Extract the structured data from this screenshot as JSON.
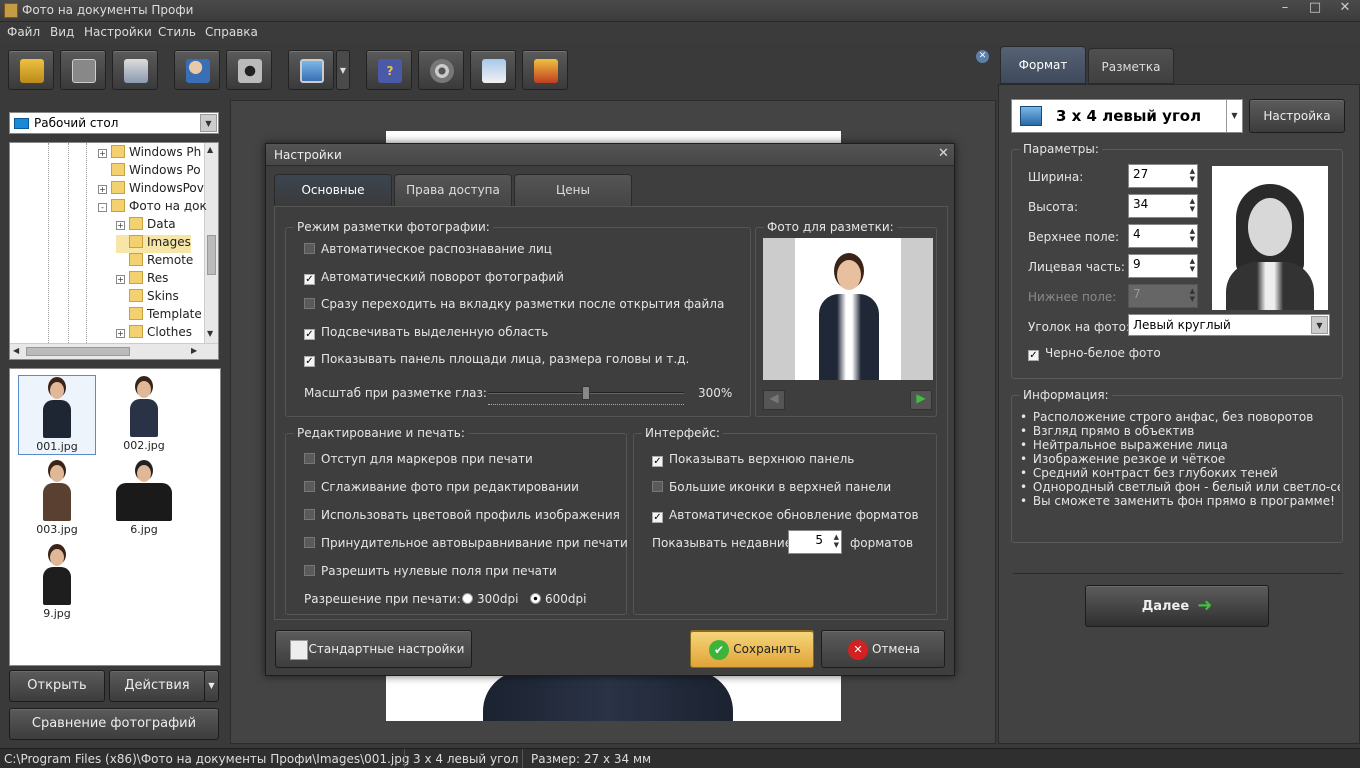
{
  "window": {
    "title": "Фото на документы Профи"
  },
  "menu": [
    "Файл",
    "Вид",
    "Настройки",
    "Стиль",
    "Справка"
  ],
  "left": {
    "folder_select": "Рабочий стол",
    "tree": [
      {
        "label": "Windows Ph",
        "exp": "+",
        "lvl": 0
      },
      {
        "label": "Windows Po",
        "exp": "",
        "lvl": 0
      },
      {
        "label": "WindowsPov",
        "exp": "+",
        "lvl": 0
      },
      {
        "label": "Фото на док",
        "exp": "−",
        "lvl": 0
      },
      {
        "label": "Data",
        "exp": "+",
        "lvl": 1
      },
      {
        "label": "Images",
        "exp": "",
        "lvl": 1
      },
      {
        "label": "Remote",
        "exp": "",
        "lvl": 1
      },
      {
        "label": "Res",
        "exp": "+",
        "lvl": 1
      },
      {
        "label": "Skins",
        "exp": "",
        "lvl": 1
      },
      {
        "label": "Template",
        "exp": "",
        "lvl": 1
      },
      {
        "label": "Clothes",
        "exp": "+",
        "lvl": 1
      }
    ],
    "thumbs": [
      "001.jpg",
      "002.jpg",
      "003.jpg",
      "6.jpg",
      "9.jpg"
    ],
    "btn_open": "Открыть",
    "btn_actions": "Действия",
    "btn_compare": "Сравнение фотографий"
  },
  "dialog": {
    "title": "Настройки",
    "tabs": [
      "Основные",
      "Права доступа",
      "Цены"
    ],
    "markup_group": "Режим разметки фотографии:",
    "markup_opts": [
      {
        "label": "Автоматическое распознавание лиц",
        "checked": false
      },
      {
        "label": "Автоматический поворот фотографий",
        "checked": true
      },
      {
        "label": "Сразу переходить на вкладку разметки после открытия файла",
        "checked": false
      },
      {
        "label": "Подсвечивать выделенную область",
        "checked": true
      },
      {
        "label": "Показывать панель площади лица, размера головы и т.д.",
        "checked": true
      }
    ],
    "scale_label": "Масштаб при разметке глаз:",
    "scale_value": "300%",
    "scale_fraction": 0.5,
    "photo_group": "Фото для разметки:",
    "edit_group": "Редактирование и печать:",
    "edit_opts": [
      {
        "label": "Отступ для маркеров при печати",
        "checked": false
      },
      {
        "label": "Сглаживание фото при редактировании",
        "checked": false
      },
      {
        "label": "Использовать цветовой профиль изображения",
        "checked": false
      },
      {
        "label": "Принудительное автовыравнивание при печати",
        "checked": false
      },
      {
        "label": "Разрешить нулевые поля при печати",
        "checked": false
      }
    ],
    "dpi_label": "Разрешение при печати:",
    "dpi_300": "300dpi",
    "dpi_600": "600dpi",
    "iface_group": "Интерфейс:",
    "iface_opts": [
      {
        "label": "Показывать верхнюю панель",
        "checked": true
      },
      {
        "label": "Большие иконки в верхней панели",
        "checked": false
      },
      {
        "label": "Автоматическое обновление форматов",
        "checked": true
      }
    ],
    "recent_label": "Показывать недавние",
    "recent_value": "5",
    "recent_suffix": "форматов",
    "btn_defaults": "Стандартные настройки",
    "btn_save": "Сохранить",
    "btn_cancel": "Отмена"
  },
  "right": {
    "tabs": [
      "Формат",
      "Разметка"
    ],
    "format": "3 x 4 левый угол",
    "btn_setup": "Настройка",
    "params_group": "Параметры:",
    "fields": [
      {
        "label": "Ширина:",
        "value": "27",
        "disabled": false
      },
      {
        "label": "Высота:",
        "value": "34",
        "disabled": false
      },
      {
        "label": "Верхнее поле:",
        "value": "4",
        "disabled": false
      },
      {
        "label": "Лицевая часть:",
        "value": "9",
        "disabled": false
      },
      {
        "label": "Нижнее поле:",
        "value": "7",
        "disabled": true
      }
    ],
    "corner_label": "Уголок на фото:",
    "corner_value": "Левый круглый",
    "bw_label": "Черно-белое фото",
    "info_group": "Информация:",
    "info": [
      "Расположение строго анфас, без поворотов",
      "Взгляд прямо в объектив",
      "Нейтральное выражение лица",
      "Изображение резкое и чёткое",
      "Средний контраст без глубоких теней",
      "Однородный светлый фон - белый или светло-сер...",
      "Вы сможете заменить фон прямо в программе!"
    ],
    "btn_next": "Далее"
  },
  "status": {
    "path": "C:\\Program Files (x86)\\Фото на документы Профи\\Images\\001.jpg",
    "format": "3 x 4 левый угол",
    "size": "Размер: 27 x 34 мм"
  }
}
